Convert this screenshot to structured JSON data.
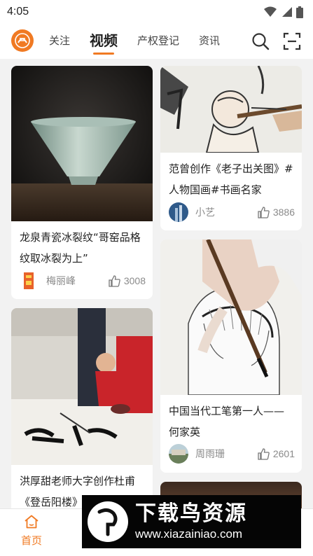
{
  "status_bar": {
    "time": "4:05"
  },
  "nav": {
    "tabs": [
      {
        "label": "关注",
        "active": false
      },
      {
        "label": "视频",
        "active": true
      },
      {
        "label": "产权登记",
        "active": false
      },
      {
        "label": "资讯",
        "active": false
      }
    ],
    "accent_color": "#f07a23",
    "icons": [
      "logo-icon",
      "search-icon",
      "scan-icon"
    ]
  },
  "feed": {
    "cards": [
      {
        "title": "龙泉青瓷冰裂纹“哥窑品格纹取冰裂为上”",
        "author": "梅丽峰",
        "likes": "3008"
      },
      {
        "title": "范曾创作《老子出关图》#人物国画#书画名家",
        "author": "小艺",
        "likes": "3886"
      },
      {
        "title": "洪厚甜老师大字创作杜甫《登岳阳楼》",
        "author": "",
        "likes": ""
      },
      {
        "title": "中国当代工笔第一人——何家英",
        "author": "周雨珊",
        "likes": "2601"
      }
    ]
  },
  "bottom_nav": {
    "home_label": "首页"
  },
  "watermark": {
    "title": "下载鸟资源",
    "url": "www.xiazainiao.com"
  }
}
